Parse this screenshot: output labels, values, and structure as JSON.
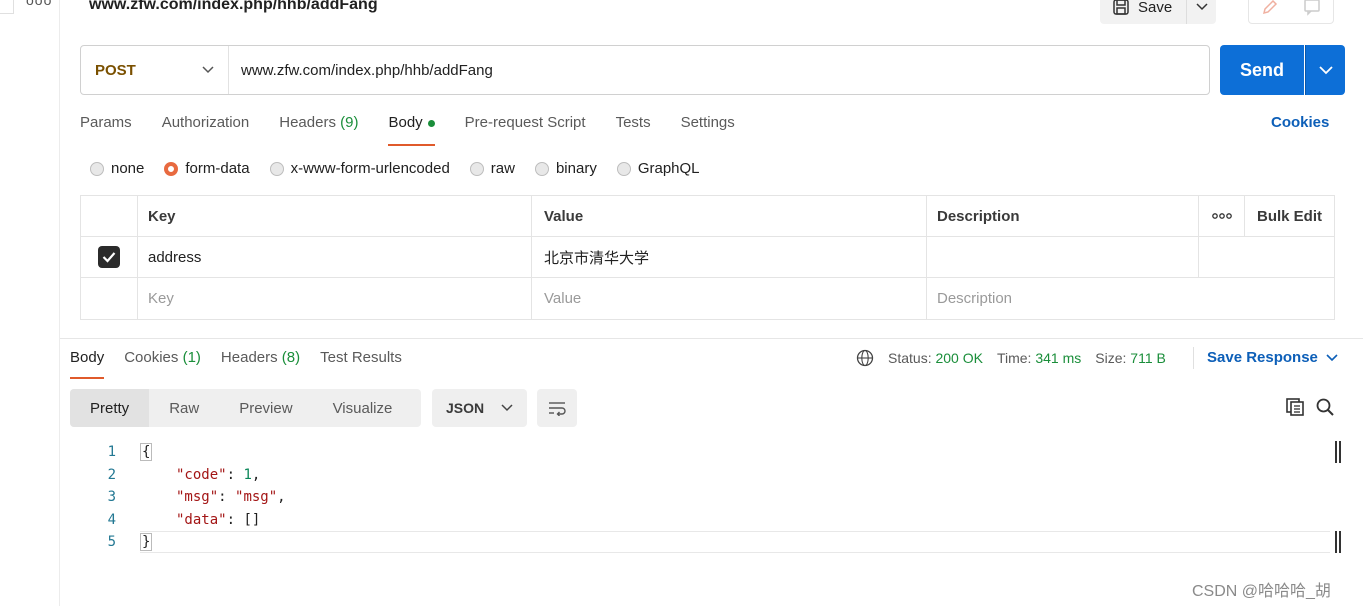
{
  "request": {
    "title": "www.zfw.com/index.php/hhb/addFang",
    "save_label": "Save",
    "method": "POST",
    "url": "www.zfw.com/index.php/hhb/addFang",
    "send_label": "Send"
  },
  "req_tabs": [
    {
      "label": "Params"
    },
    {
      "label": "Authorization"
    },
    {
      "label": "Headers",
      "count": "(9)"
    },
    {
      "label": "Body"
    },
    {
      "label": "Pre-request Script"
    },
    {
      "label": "Tests"
    },
    {
      "label": "Settings"
    }
  ],
  "cookies_link": "Cookies",
  "body_types": [
    "none",
    "form-data",
    "x-www-form-urlencoded",
    "raw",
    "binary",
    "GraphQL"
  ],
  "body_type_selected": "form-data",
  "form_table": {
    "headers": {
      "key": "Key",
      "value": "Value",
      "description": "Description",
      "bulk_edit": "Bulk Edit",
      "more": "ooo"
    },
    "rows": [
      {
        "key": "address",
        "value": "北京市清华大学",
        "description": "",
        "checked": true
      }
    ],
    "placeholder": {
      "key": "Key",
      "value": "Value",
      "description": "Description"
    }
  },
  "resp_tabs": [
    {
      "label": "Body"
    },
    {
      "label": "Cookies",
      "count": "(1)"
    },
    {
      "label": "Headers",
      "count": "(8)"
    },
    {
      "label": "Test Results"
    }
  ],
  "status": {
    "status_label": "Status:",
    "status_value": "200 OK",
    "time_label": "Time:",
    "time_value": "341 ms",
    "size_label": "Size:",
    "size_value": "711 B"
  },
  "save_response": "Save Response",
  "view_modes": [
    "Pretty",
    "Raw",
    "Preview",
    "Visualize"
  ],
  "format": "JSON",
  "code": {
    "line_numbers": [
      "1",
      "2",
      "3",
      "4",
      "5"
    ],
    "open_brace": "{",
    "close_brace": "}",
    "k_code": "\"code\"",
    "v_code": "1",
    "k_msg": "\"msg\"",
    "v_msg": "\"msg\"",
    "k_data": "\"data\"",
    "v_data": "[]",
    "colon": ": ",
    "comma": ","
  },
  "watermark": "CSDN @哈哈哈_胡",
  "colors": {
    "accent": "#0d6fd7",
    "tab_underline": "#e05a2b",
    "status_green": "#1a8e3a",
    "link": "#0d5fb8"
  }
}
